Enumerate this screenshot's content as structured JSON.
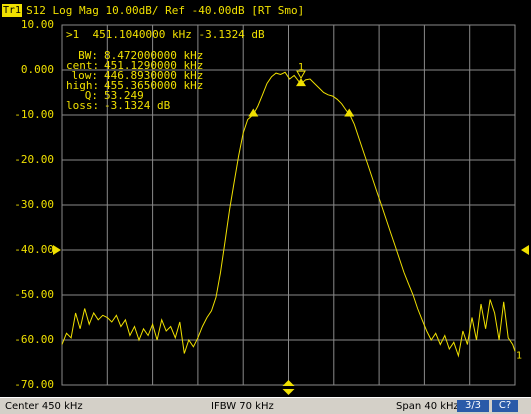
{
  "header": {
    "trace_badge": "Tr1",
    "trace_description": "S12 Log Mag 10.00dB/ Ref -40.00dB [RT Smo]"
  },
  "y_axis": {
    "ticks": [
      "10.00",
      "0.000",
      "-10.00",
      "-20.00",
      "-30.00",
      "-40.00",
      "-50.00",
      "-60.00",
      "-70.00"
    ]
  },
  "marker": {
    "readout": ">1  451.1040000 kHz -3.1324 dB",
    "label": "1",
    "trace_end_label": "1"
  },
  "bandwidth": {
    "rows": [
      {
        "label": "BW:",
        "value": "8.472000000 kHz"
      },
      {
        "label": "cent:",
        "value": "451.1290000 kHz"
      },
      {
        "label": "low:",
        "value": "446.8930000 kHz"
      },
      {
        "label": "high:",
        "value": "455.3650000 kHz"
      },
      {
        "label": "Q:",
        "value": "53.249"
      },
      {
        "label": "loss:",
        "value": "-3.1324 dB"
      }
    ]
  },
  "status_bar": {
    "center": "Center 450 kHz",
    "ifbw": "IFBW 70 kHz",
    "span": "Span 40 kHz",
    "page": "3/3",
    "channel": "C?"
  },
  "colors": {
    "background": "#000000",
    "trace": "#f0e000",
    "grid": "#8a8a8a",
    "status_bar": "#d4d0c8",
    "status_box": "#2a5aa8"
  },
  "chart_data": {
    "type": "line",
    "x_unit": "kHz",
    "y_unit": "dB",
    "xlim": [
      430,
      470
    ],
    "ylim": [
      -70,
      10
    ],
    "grid": true,
    "reference_level": -40,
    "scale_per_div": 10,
    "center": 450,
    "span": 40,
    "marker": {
      "x": 451.104,
      "y": -3.1324
    },
    "bandwidth_markers": [
      {
        "x": 446.893,
        "y": -9.9
      },
      {
        "x": 455.365,
        "y": -9.9
      }
    ],
    "series": [
      {
        "x": [
          430.0,
          430.4,
          430.8,
          431.2,
          431.6,
          432.0,
          432.4,
          432.8,
          433.2,
          433.6,
          434.0,
          434.4,
          434.8,
          435.2,
          435.6,
          436.0,
          436.4,
          436.8,
          437.2,
          437.6,
          438.0,
          438.4,
          438.8,
          439.2,
          439.6,
          440.0,
          440.4,
          440.8,
          441.2,
          441.6,
          442.0,
          442.4,
          442.8,
          443.2,
          443.6,
          444.0,
          444.4,
          444.8,
          445.2,
          445.6,
          446.0,
          446.4,
          446.9,
          447.3,
          447.7,
          448.1,
          448.5,
          448.9,
          449.3,
          449.7,
          450.1,
          450.5,
          450.9,
          451.1,
          451.5,
          451.9,
          452.3,
          452.7,
          453.1,
          453.5,
          453.9,
          454.3,
          454.7,
          455.1,
          455.4,
          455.8,
          456.2,
          456.6,
          457.0,
          457.4,
          457.8,
          458.2,
          458.6,
          459.0,
          459.4,
          459.8,
          460.2,
          460.6,
          461.0,
          461.4,
          461.8,
          462.2,
          462.6,
          463.0,
          463.4,
          463.8,
          464.2,
          464.6,
          465.0,
          465.4,
          465.8,
          466.2,
          466.6,
          467.0,
          467.4,
          467.8,
          468.2,
          468.6,
          469.0,
          469.4,
          469.8,
          470.0
        ],
        "y": [
          -61.0,
          -58.5,
          -59.5,
          -54.0,
          -57.5,
          -53.0,
          -56.5,
          -54.0,
          -55.5,
          -54.5,
          -55.0,
          -56.0,
          -54.5,
          -57.0,
          -55.5,
          -59.0,
          -57.0,
          -60.0,
          -57.5,
          -59.0,
          -56.5,
          -60.0,
          -55.5,
          -58.0,
          -57.0,
          -59.5,
          -56.0,
          -63.0,
          -60.0,
          -61.5,
          -59.5,
          -57.0,
          -55.0,
          -53.5,
          -50.5,
          -45.0,
          -38.0,
          -31.0,
          -25.0,
          -19.0,
          -14.0,
          -11.0,
          -9.9,
          -8.0,
          -5.5,
          -3.0,
          -1.5,
          -0.7,
          -1.0,
          -0.5,
          -2.0,
          -1.2,
          -2.5,
          -3.1,
          -2.2,
          -2.0,
          -3.0,
          -4.0,
          -5.0,
          -5.5,
          -5.8,
          -6.5,
          -7.5,
          -9.0,
          -9.9,
          -12.0,
          -15.0,
          -18.0,
          -21.0,
          -24.0,
          -27.0,
          -30.0,
          -33.0,
          -36.0,
          -39.0,
          -42.0,
          -45.0,
          -47.5,
          -50.0,
          -53.0,
          -55.5,
          -58.0,
          -60.0,
          -58.5,
          -61.0,
          -59.0,
          -62.0,
          -60.5,
          -63.5,
          -58.0,
          -61.0,
          -55.0,
          -60.0,
          -52.0,
          -57.5,
          -51.0,
          -54.0,
          -60.0,
          -51.5,
          -59.5,
          -61.0,
          -62.5
        ]
      }
    ]
  }
}
